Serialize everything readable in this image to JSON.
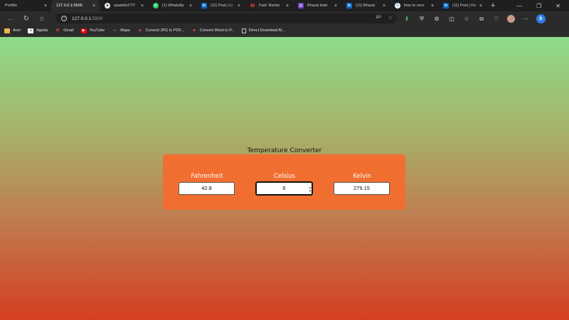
{
  "browser": {
    "tabs": [
      {
        "title": "Portfiio",
        "icon": "page-icon",
        "active": false
      },
      {
        "title": "127.0.0.1:5500",
        "icon": "page-icon",
        "active": true
      },
      {
        "title": "spadole27/T",
        "icon": "github-icon",
        "active": false
      },
      {
        "title": "(1) WhatsAp",
        "icon": "whatsapp-icon",
        "active": false
      },
      {
        "title": "(11) Post | Li",
        "icon": "linkedin-icon",
        "active": false
      },
      {
        "title": "Fwd: Remin",
        "icon": "gmail-icon",
        "active": false
      },
      {
        "title": "Bharat Inter",
        "icon": "bharat-icon",
        "active": false
      },
      {
        "title": "(11) Bharat",
        "icon": "linkedin-icon",
        "active": false
      },
      {
        "title": "how to reco",
        "icon": "google-icon",
        "active": false
      },
      {
        "title": "(11) Post | Fe",
        "icon": "linkedin-icon",
        "active": false
      }
    ],
    "address": {
      "host": "127.0.0.1",
      "port": ":5500"
    },
    "bookmarks": [
      {
        "label": "Acer",
        "icon": "folder-icon"
      },
      {
        "label": "Agoda",
        "icon": "agoda-icon"
      },
      {
        "label": "Gmail",
        "icon": "gmail-icon"
      },
      {
        "label": "YouTube",
        "icon": "youtube-icon"
      },
      {
        "label": "Maps",
        "icon": "maps-icon"
      },
      {
        "label": "Convert JPG to PDF...",
        "icon": "heart-icon"
      },
      {
        "label": "Convert Word to P...",
        "icon": "heart-icon"
      },
      {
        "label": "Direct Download Al...",
        "icon": "page-icon"
      }
    ]
  },
  "converter": {
    "title": "Temperature Converter",
    "fahrenheit": {
      "label": "Fahrenheit",
      "value": "42.8"
    },
    "celsius": {
      "label": "Celsius",
      "value": "6"
    },
    "kelvin": {
      "label": "Kelvin",
      "value": "279.15"
    }
  },
  "colors": {
    "card": "#f06f30",
    "gradient_top": "#8edb8b",
    "gradient_bottom": "#d43f20"
  }
}
